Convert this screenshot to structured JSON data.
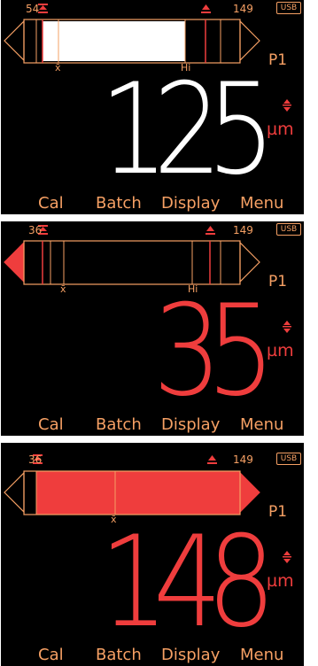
{
  "screens": [
    {
      "range_min": "54",
      "range_max": "149",
      "usb_label": "USB",
      "profile": "P1",
      "reading": "125",
      "unit": "µm",
      "reading_color": "#ffffff",
      "bar_fill_fraction": 0.75,
      "bar_fill_color": "#ffffff",
      "mean_label": "x̄",
      "hi_label": "Hi",
      "left_arrow_active": false,
      "right_arrow_active": false,
      "softkeys": [
        "Cal",
        "Batch",
        "Display",
        "Menu"
      ]
    },
    {
      "range_min": "36",
      "range_max": "149",
      "usb_label": "USB",
      "profile": "P1",
      "reading": "35",
      "unit": "µm",
      "reading_color": "#ef3d3d",
      "bar_fill_fraction": 0.0,
      "bar_fill_color": "#000000",
      "mean_label": "x̄",
      "hi_label": "Hi",
      "left_arrow_active": true,
      "right_arrow_active": false,
      "softkeys": [
        "Cal",
        "Batch",
        "Display",
        "Menu"
      ]
    },
    {
      "range_min": "36",
      "range_max": "149",
      "usb_label": "USB",
      "profile": "P1",
      "reading": "148",
      "unit": "µm",
      "reading_color": "#ef3d3d",
      "bar_fill_fraction": 1.0,
      "bar_fill_color": "#ef3d3d",
      "mean_label": "x̄",
      "hi_label": "",
      "left_arrow_active": false,
      "right_arrow_active": true,
      "softkeys": [
        "Cal",
        "Batch",
        "Display",
        "Menu"
      ]
    }
  ],
  "colors": {
    "orange": "#f6a064",
    "red": "#ef3d3d",
    "background": "#000000"
  },
  "icons": {
    "limit_marker": "limit-marker-icon",
    "unit_arrows": "up-down-arrows-icon"
  }
}
